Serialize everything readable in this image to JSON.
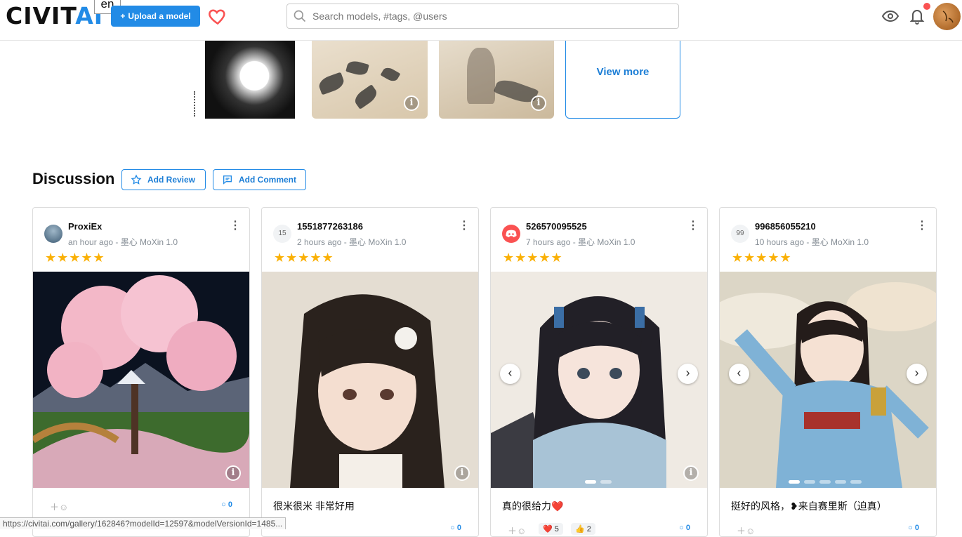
{
  "header": {
    "logo": {
      "main": "CIVIT",
      "accent": "AI"
    },
    "lang_tooltip": "en",
    "upload_label": "Upload a model",
    "search_placeholder": "Search models, #tags, @users"
  },
  "gallery": {
    "view_more": "View more"
  },
  "discussion": {
    "title": "Discussion",
    "add_review": "Add Review",
    "add_comment": "Add Comment",
    "cards": [
      {
        "user": "ProxiEx",
        "meta": "an hour ago - 墨心 MoXin 1.0",
        "stars": "★★★★★",
        "text": "",
        "comments": "0",
        "avatar": ""
      },
      {
        "user": "1551877263186",
        "meta": "2 hours ago - 墨心 MoXin 1.0",
        "stars": "★★★★★",
        "text": "很米很米 非常好用",
        "comments": "0",
        "avatar": "15"
      },
      {
        "user": "526570095525",
        "meta": "7 hours ago - 墨心 MoXin 1.0",
        "stars": "★★★★★",
        "text": "真的很给力❤️",
        "comments": "0",
        "avatar": "",
        "reactions": [
          {
            "emoji": "❤️",
            "count": "5"
          },
          {
            "emoji": "👍",
            "count": "2"
          }
        ]
      },
      {
        "user": "996856055210",
        "meta": "10 hours ago - 墨心 MoXin 1.0",
        "stars": "★★★★★",
        "text": "挺好的风格，❥来自赛里斯（迫真）",
        "comments": "0",
        "avatar": "99"
      }
    ]
  },
  "status_url": "https://civitai.com/gallery/162846?modelId=12597&modelVersionId=1485...",
  "colors": {
    "accent": "#228be6",
    "star": "#fab005",
    "notification": "#fa5252",
    "heart": "#fa5252"
  }
}
